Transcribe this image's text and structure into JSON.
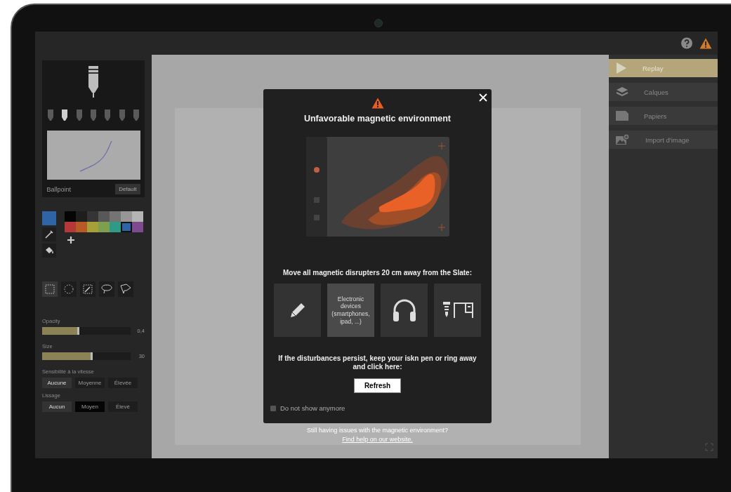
{
  "brush": {
    "pens": [
      {
        "selected": false
      },
      {
        "selected": true
      },
      {
        "selected": false
      },
      {
        "selected": false
      },
      {
        "selected": false
      },
      {
        "selected": false
      },
      {
        "selected": false
      }
    ],
    "name": "Ballpoint",
    "reset_button": "Default"
  },
  "colors": {
    "palette": [
      {
        "color": "#050505",
        "selected": false
      },
      {
        "color": "#1e1e1e",
        "selected": false
      },
      {
        "color": "#353535",
        "selected": false
      },
      {
        "color": "#585858",
        "selected": false
      },
      {
        "color": "#747474",
        "selected": false
      },
      {
        "color": "#969696",
        "selected": false
      },
      {
        "color": "#b4b4b4",
        "selected": false
      },
      {
        "color": "#b43838",
        "selected": false
      },
      {
        "color": "#b65a26",
        "selected": false
      },
      {
        "color": "#a5a03a",
        "selected": false
      },
      {
        "color": "#7ea04e",
        "selected": false
      },
      {
        "color": "#2f9a86",
        "selected": false
      },
      {
        "color": "#2f64a6",
        "selected": true
      },
      {
        "color": "#7e4a8e",
        "selected": false
      }
    ]
  },
  "selection_tools": [
    {
      "kind": "rect",
      "selected": true
    },
    {
      "kind": "ellipse",
      "selected": false
    },
    {
      "kind": "wand",
      "selected": false
    },
    {
      "kind": "lasso",
      "selected": false
    },
    {
      "kind": "polygon",
      "selected": false
    }
  ],
  "sliders": [
    {
      "label": "Opacity",
      "level": 0.42,
      "reading": "0,4"
    },
    {
      "label": "Size",
      "level": 0.57,
      "reading": "30"
    }
  ],
  "option_groups": [
    {
      "label": "Sensibilité à la vitesse",
      "options": [
        {
          "label": "Aucune",
          "selected": true,
          "hovered": false
        },
        {
          "label": "Moyenne",
          "selected": false,
          "hovered": false
        },
        {
          "label": "Élevée",
          "selected": false,
          "hovered": false
        }
      ]
    },
    {
      "label": "Lissage",
      "options": [
        {
          "label": "Aucun",
          "selected": true,
          "hovered": false
        },
        {
          "label": "Moyen",
          "selected": false,
          "hovered": true
        },
        {
          "label": "Élevé",
          "selected": false,
          "hovered": false
        }
      ]
    }
  ],
  "menu": [
    {
      "kind": "play",
      "label": "Replay",
      "selected": true
    },
    {
      "kind": "layers",
      "label": "Calques",
      "selected": false
    },
    {
      "kind": "paper",
      "label": "Papiers",
      "selected": false
    },
    {
      "kind": "image",
      "label": "Import d'image",
      "selected": false
    }
  ],
  "dialog": {
    "title": "Unfavorable magnetic environment",
    "instruction": "Move all magnetic disrupters 20 cm away from the Slate:",
    "disrupters": [
      {
        "kind": "pencil",
        "hovered": false
      },
      {
        "kind": "text",
        "text": "Electronic devices (smartphones, ipad, ...)",
        "hovered": true
      },
      {
        "kind": "headphones",
        "hovered": false
      },
      {
        "kind": "furniture",
        "hovered": false
      }
    ],
    "persist_text": "If the disturbances persist, keep your iskn pen or ring away and click here:",
    "refresh_button": "Refresh",
    "dont_show": {
      "label": "Do not show anymore",
      "checked": false
    }
  },
  "help_text": "Still having issues with the magnetic environment?",
  "help_link": "Find help on our website."
}
